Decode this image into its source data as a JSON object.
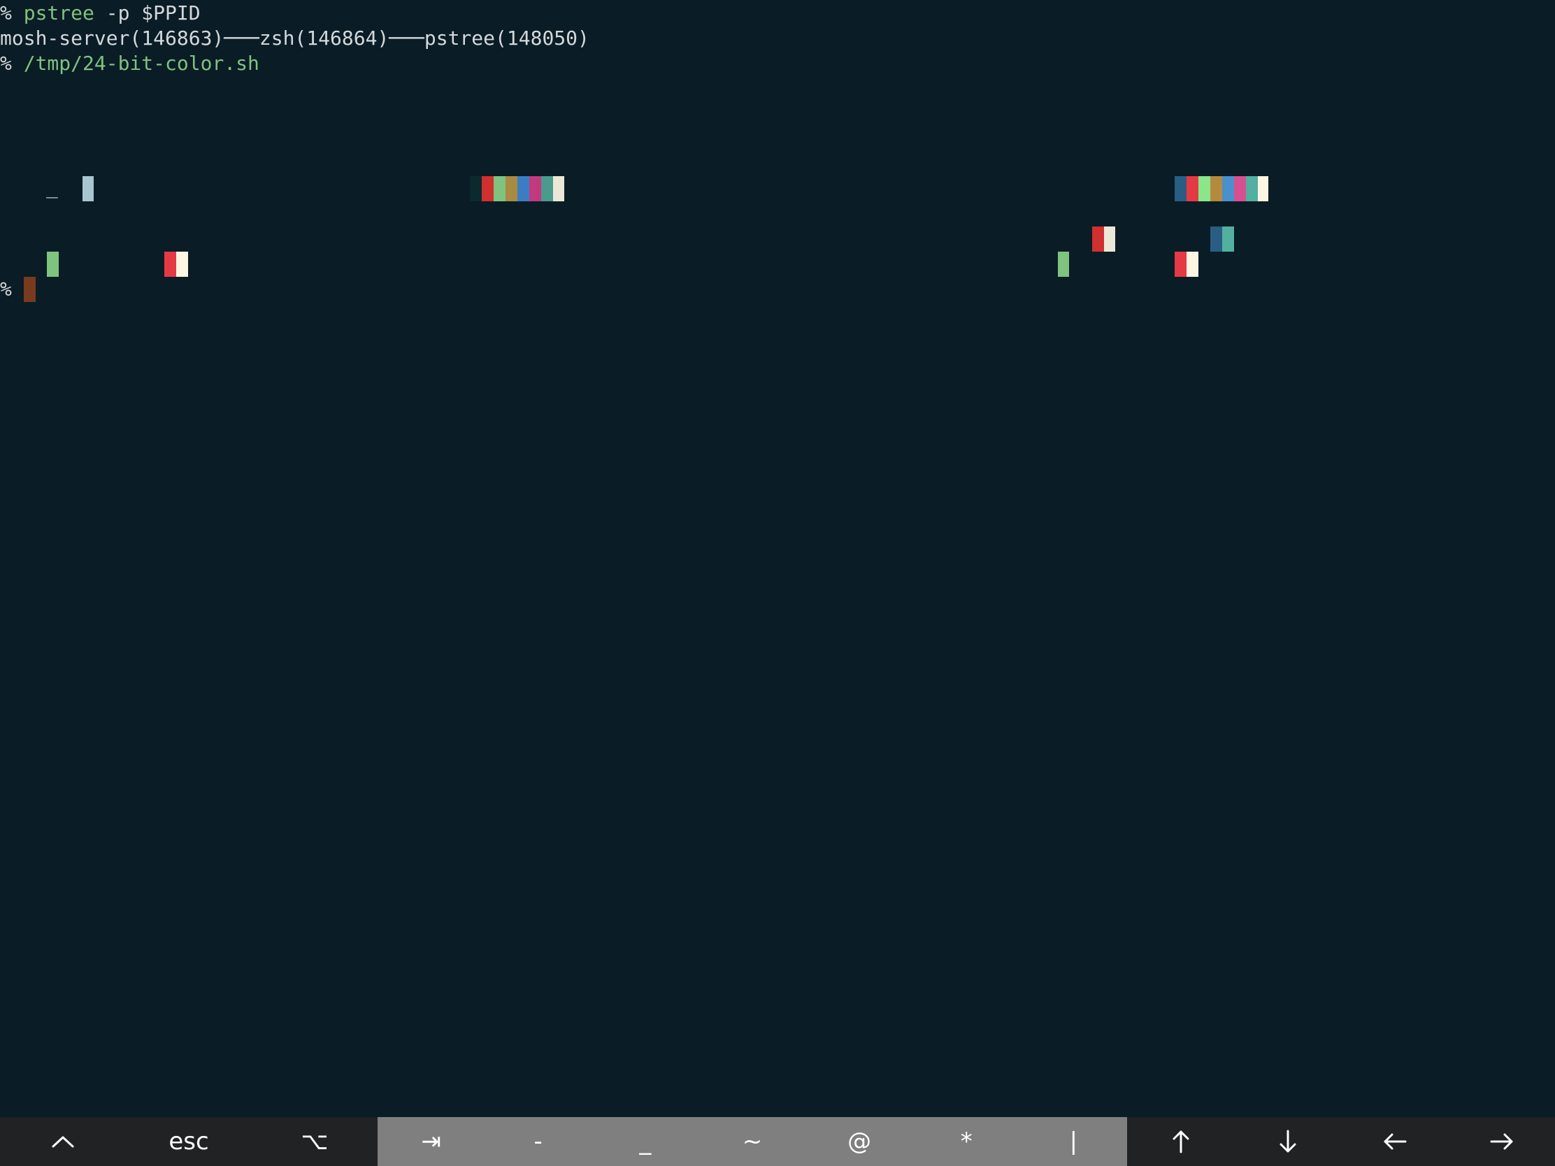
{
  "terminal": {
    "lines": {
      "l1_prompt": "% ",
      "l1_cmd": "pstree",
      "l1_args": " -p $PPID",
      "l2_output": "mosh-server(146863)───zsh(146864)───pstree(148050)",
      "l3_prompt": "% ",
      "l3_cmd": "/tmp/24-bit-color.sh",
      "final_prompt": "%",
      "underscore_glyph": "_"
    },
    "colors": {
      "background": "#0a1c26",
      "foreground": "#d4d8db",
      "command": "#7fc37f",
      "cursor": "#7a3a1e"
    },
    "color_swatches": [
      "#a8c6d0",
      "#0b2a2e",
      "#d0302e",
      "#7fc37f",
      "#a88a40",
      "#3b7dc4",
      "#c23a7e",
      "#4a9a8e",
      "#ece8d8",
      "#2a5d84",
      "#e63946",
      "#8ae68a",
      "#b38a3e",
      "#4a90cc",
      "#d65090",
      "#52b0a0",
      "#fdf6e3"
    ]
  },
  "keyboard_bar": {
    "left_keys": [
      {
        "icon": "ctrl-caret-icon"
      },
      {
        "label": "esc"
      },
      {
        "label": "⌥",
        "icon": "option-icon"
      }
    ],
    "middle_keys": [
      {
        "label": "⇥",
        "icon": "tab-icon"
      },
      {
        "label": "-"
      },
      {
        "label": "_"
      },
      {
        "label": "~"
      },
      {
        "label": "@"
      },
      {
        "label": "*"
      },
      {
        "label": "|"
      }
    ],
    "right_keys": [
      {
        "icon": "arrow-up-icon"
      },
      {
        "icon": "arrow-down-icon"
      },
      {
        "icon": "arrow-left-icon"
      },
      {
        "icon": "arrow-right-icon"
      }
    ]
  }
}
